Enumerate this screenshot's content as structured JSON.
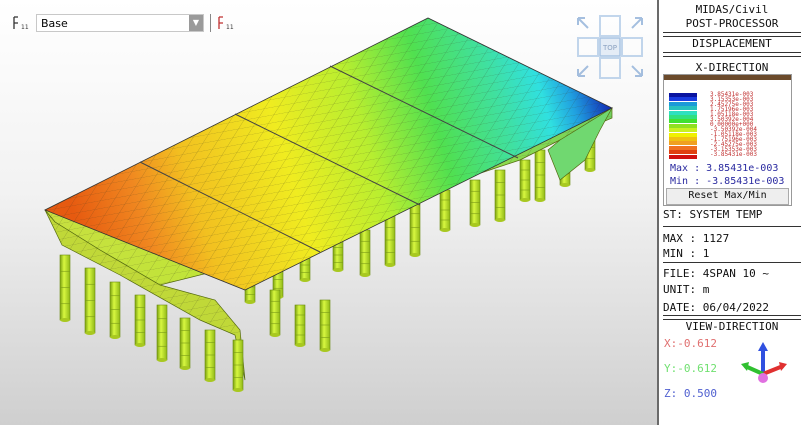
{
  "toolbar": {
    "stage_combo_value": "Base",
    "left_icon_label": "11",
    "right_icon_label": "11"
  },
  "viewcube": {
    "face_label": "TOP"
  },
  "panel": {
    "app_title": "MIDAS/Civil",
    "app_subtitle": "POST-PROCESSOR",
    "result_type": "DISPLACEMENT",
    "component": "X-DIRECTION",
    "legend": {
      "colors": [
        "#0a14a0",
        "#1a3ae0",
        "#1a9ad8",
        "#26c0c0",
        "#2ee0c0",
        "#30e080",
        "#40e030",
        "#90e020",
        "#c8f020",
        "#f0f000",
        "#f0c010",
        "#f0a020",
        "#f07020",
        "#e04010",
        "#d01010"
      ],
      "labels": [
        "3.85431e-003",
        "3.15353e-003",
        "2.45275e-003",
        "1.75196e-003",
        "1.05118e-003",
        "3.50392e-004",
        "0.00000e+000",
        "-3.50392e-004",
        "-1.05118e-003",
        "-1.75196e-003",
        "-2.45275e-003",
        "-3.15353e-003",
        "-3.85431e-003"
      ],
      "max_text": "Max : 3.85431e-003",
      "min_text": "Min : -3.85431e-003",
      "reset_label": "Reset Max/Min"
    },
    "st_text": "ST: SYSTEM TEMP",
    "max_node": "MAX : 1127",
    "min_node": "MIN : 1",
    "file": "FILE: 4SPAN 10 ~",
    "unit": "UNIT: m",
    "date": "DATE: 06/04/2022",
    "view_direction_title": "VIEW-DIRECTION",
    "view_x": "X:-0.612",
    "view_y": "Y:-0.612",
    "view_z": "Z: 0.500",
    "axis_colors": {
      "x": "#e03030",
      "y": "#30c030",
      "z": "#3050e0"
    }
  }
}
